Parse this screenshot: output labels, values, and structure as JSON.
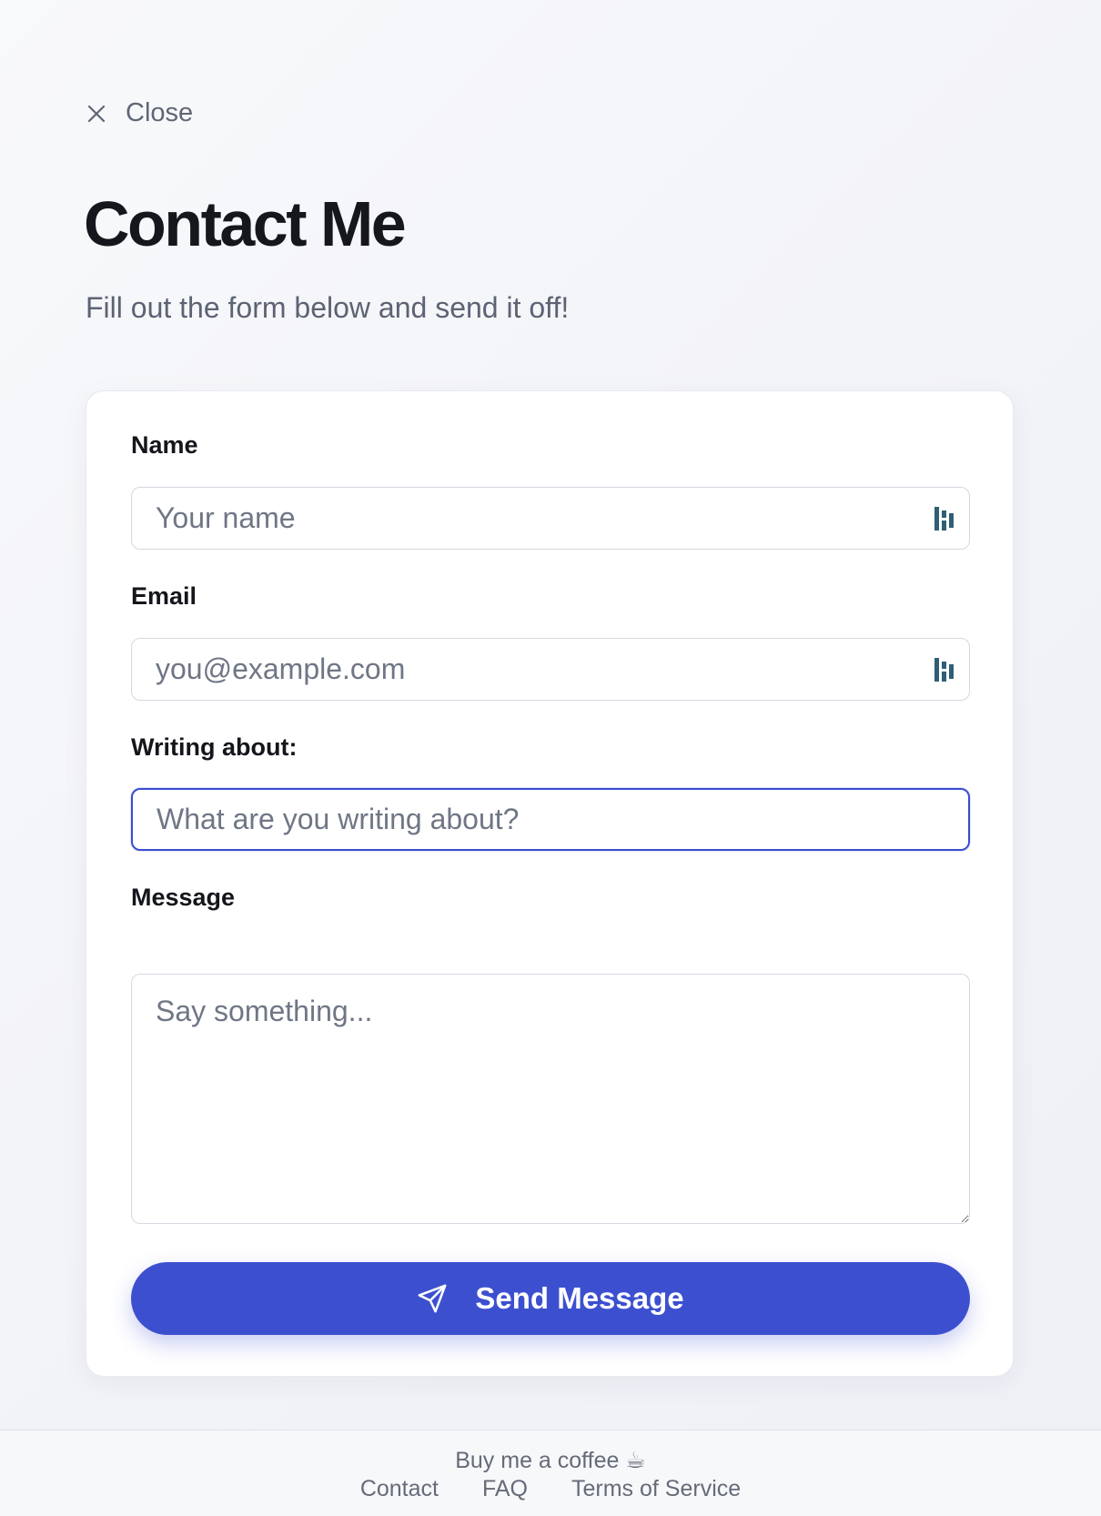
{
  "close": {
    "label": "Close",
    "icon": "close-icon"
  },
  "header": {
    "title": "Contact Me",
    "subtitle": "Fill out the form below and send it off!"
  },
  "form": {
    "name": {
      "label": "Name",
      "placeholder": "Your name",
      "value": ""
    },
    "email": {
      "label": "Email",
      "placeholder": "you@example.com",
      "value": ""
    },
    "subject": {
      "label": "Writing about:",
      "placeholder": "What are you writing about?",
      "value": "",
      "focused": true
    },
    "message": {
      "label": "Message",
      "placeholder": "Say something...",
      "value": ""
    },
    "submit": {
      "label": "Send Message",
      "icon": "send-icon"
    }
  },
  "footer": {
    "coffee": "Buy me a coffee ☕",
    "links": [
      "Contact",
      "FAQ",
      "Terms of Service"
    ]
  },
  "colors": {
    "accent": "#3c50cf",
    "focus_border": "#3a4ed0",
    "autofill_icon": "#2f5f73"
  }
}
